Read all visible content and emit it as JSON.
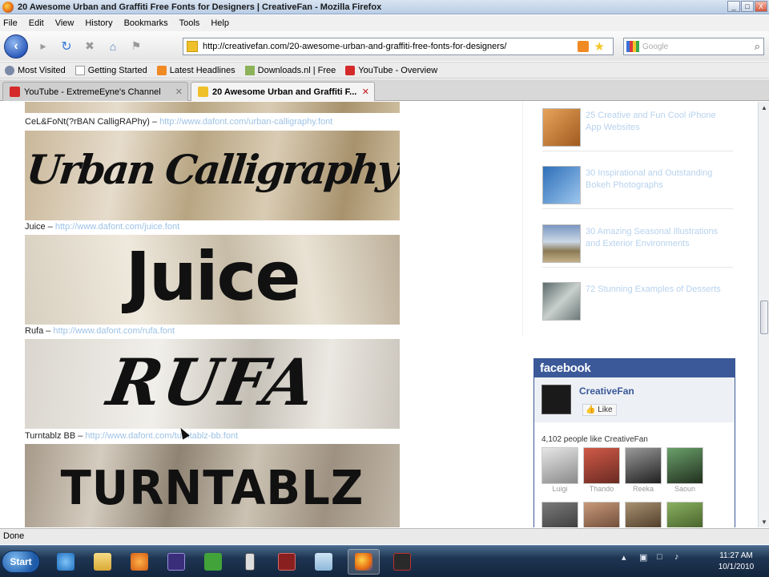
{
  "window": {
    "title": "20 Awesome Urban and Graffiti Free Fonts for Designers | CreativeFan - Mozilla Firefox",
    "controls": [
      "_",
      "□",
      "X"
    ]
  },
  "menu": [
    "File",
    "Edit",
    "View",
    "History",
    "Bookmarks",
    "Tools",
    "Help"
  ],
  "nav": {
    "url": "http://creativefan.com/20-awesome-urban-and-graffiti-free-fonts-for-designers/",
    "search_placeholder": "Google"
  },
  "bookmarks": [
    {
      "label": "Most Visited",
      "icon": "gear-icon"
    },
    {
      "label": "Getting Started",
      "icon": "page-icon"
    },
    {
      "label": "Latest Headlines",
      "icon": "rss-icon"
    },
    {
      "label": "Downloads.nl | Free",
      "icon": "download-icon"
    },
    {
      "label": "YouTube - Overview",
      "icon": "youtube-icon"
    }
  ],
  "tabs": [
    {
      "label": "YouTube - ExtremeEyne's Channel",
      "active": false
    },
    {
      "label": "20 Awesome Urban and Graffiti F...",
      "active": true
    }
  ],
  "fonts": [
    {
      "caption": "CeL&FoNt(?rBAN CalligRAPhy) –",
      "link": "http://www.dafont.com/urban-calligraphy.font",
      "sample": "Urban Calligraphy"
    },
    {
      "caption": "Juice –",
      "link": "http://www.dafont.com/juice.font",
      "sample": "Juice"
    },
    {
      "caption": "Rufa –",
      "link": "http://www.dafont.com/rufa.font",
      "sample": "RUFA"
    },
    {
      "caption": "Turntablz BB –",
      "link": "http://www.dafont.com/turntablz-bb.font",
      "sample": "TURNTABLZ"
    }
  ],
  "related_posts": [
    {
      "title": "25 Creative and Fun Cool iPhone App Websites"
    },
    {
      "title": "30 Inspirational and Outstanding Bokeh Photographs"
    },
    {
      "title": "30 Amazing Seasonal Illustrations and Exterior Environments"
    },
    {
      "title": "72 Stunning Examples of Desserts"
    }
  ],
  "facebook": {
    "header": "facebook",
    "page_name": "CreativeFan",
    "like_label": "Like",
    "count_text": "4,102 people like CreativeFan",
    "fans": [
      {
        "name": "Luigi"
      },
      {
        "name": "Thando"
      },
      {
        "name": "Reeka"
      },
      {
        "name": "Saoun"
      },
      {
        "name": ""
      },
      {
        "name": ""
      },
      {
        "name": ""
      },
      {
        "name": ""
      }
    ]
  },
  "status": {
    "text": "Done"
  },
  "taskbar": {
    "start_label": "Start",
    "clock_time": "11:27 AM",
    "clock_date": "10/1/2010"
  }
}
